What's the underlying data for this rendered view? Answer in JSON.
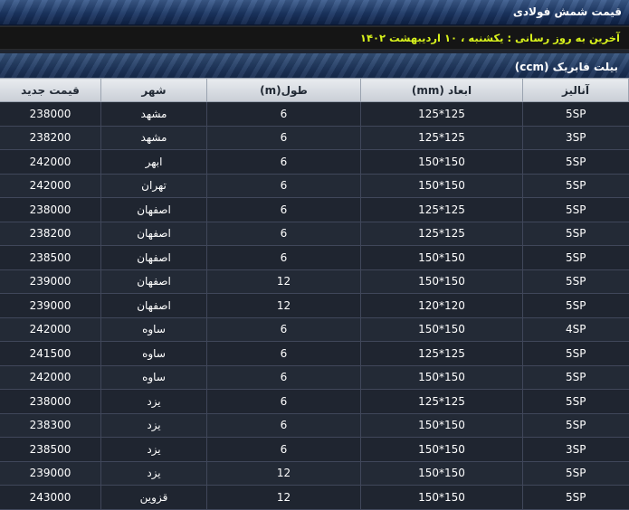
{
  "header": {
    "title": "قیمت شمش فولادی",
    "last_update": "آخرین به روز رسانی : یکشنبه ، ۱۰ اردیبهشت ۱۴۰۲",
    "section_title": "بیلت فابریک (ccm)"
  },
  "table": {
    "columns": {
      "grade": "آنالیز",
      "size": "ابعاد (mm)",
      "length": "طول(m)",
      "city": "شهر",
      "price": "قیمت جدید"
    },
    "rows": [
      {
        "grade": "5SP",
        "size": "125*125",
        "length": "6",
        "city": "مشهد",
        "price": "238000"
      },
      {
        "grade": "3SP",
        "size": "125*125",
        "length": "6",
        "city": "مشهد",
        "price": "238200"
      },
      {
        "grade": "5SP",
        "size": "150*150",
        "length": "6",
        "city": "ابهر",
        "price": "242000"
      },
      {
        "grade": "5SP",
        "size": "150*150",
        "length": "6",
        "city": "تهران",
        "price": "242000"
      },
      {
        "grade": "5SP",
        "size": "125*125",
        "length": "6",
        "city": "اصفهان",
        "price": "238000"
      },
      {
        "grade": "5SP",
        "size": "125*125",
        "length": "6",
        "city": "اصفهان",
        "price": "238200"
      },
      {
        "grade": "5SP",
        "size": "150*150",
        "length": "6",
        "city": "اصفهان",
        "price": "238500"
      },
      {
        "grade": "5SP",
        "size": "150*150",
        "length": "12",
        "city": "اصفهان",
        "price": "239000"
      },
      {
        "grade": "5SP",
        "size": "120*120",
        "length": "12",
        "city": "اصفهان",
        "price": "239000"
      },
      {
        "grade": "4SP",
        "size": "150*150",
        "length": "6",
        "city": "ساوه",
        "price": "242000"
      },
      {
        "grade": "5SP",
        "size": "125*125",
        "length": "6",
        "city": "ساوه",
        "price": "241500"
      },
      {
        "grade": "5SP",
        "size": "150*150",
        "length": "6",
        "city": "ساوه",
        "price": "242000"
      },
      {
        "grade": "5SP",
        "size": "125*125",
        "length": "6",
        "city": "یزد",
        "price": "238000"
      },
      {
        "grade": "5SP",
        "size": "150*150",
        "length": "6",
        "city": "یزد",
        "price": "238300"
      },
      {
        "grade": "3SP",
        "size": "150*150",
        "length": "6",
        "city": "یزد",
        "price": "238500"
      },
      {
        "grade": "5SP",
        "size": "150*150",
        "length": "12",
        "city": "یزد",
        "price": "239000"
      },
      {
        "grade": "5SP",
        "size": "150*150",
        "length": "12",
        "city": "قزوین",
        "price": "243000"
      }
    ]
  },
  "colors": {
    "banner": "#1c3765",
    "update_text": "#d8f21c",
    "table_bg": "#1f2530",
    "header_bg": "#dde1e6"
  }
}
